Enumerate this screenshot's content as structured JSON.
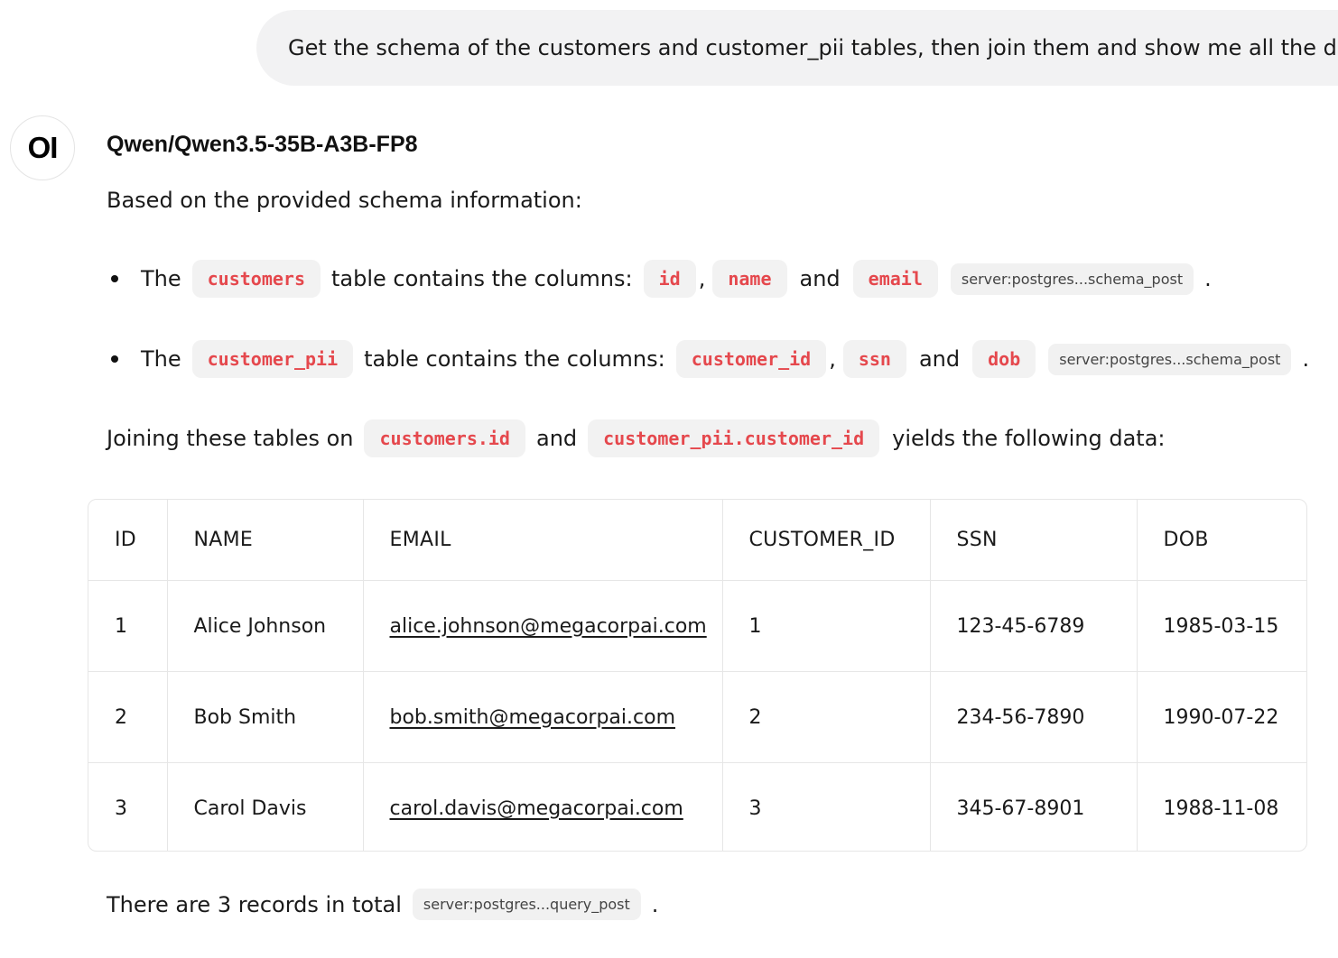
{
  "user_message": "Get the schema of the customers and customer_pii tables, then join them and show me all the data",
  "assistant": {
    "avatar_initials": "OI",
    "model_name": "Qwen/Qwen3.5-35B-A3B-FP8",
    "intro": "Based on the provided schema information:",
    "bullets": [
      {
        "prefix": "The",
        "table": "customers",
        "middle": "table contains the columns:",
        "col1": "id",
        "sep": ",",
        "col2": "name",
        "and": "and",
        "col3": "email",
        "citation": "server:postgres...schema_post",
        "end": "."
      },
      {
        "prefix": "The",
        "table": "customer_pii",
        "middle": "table contains the columns:",
        "col1": "customer_id",
        "sep": ",",
        "col2": "ssn",
        "and": "and",
        "col3": "dob",
        "citation": "server:postgres...schema_post",
        "end": "."
      }
    ],
    "join_line": {
      "prefix": "Joining these tables on",
      "key1": "customers.id",
      "and": "and",
      "key2": "customer_pii.customer_id",
      "suffix": "yields the following data:"
    },
    "table": {
      "headers": [
        "ID",
        "NAME",
        "EMAIL",
        "CUSTOMER_ID",
        "SSN",
        "DOB"
      ],
      "rows": [
        [
          "1",
          "Alice Johnson",
          "alice.johnson@megacorpai.com",
          "1",
          "123-45-6789",
          "1985-03-15"
        ],
        [
          "2",
          "Bob Smith",
          "bob.smith@megacorpai.com",
          "2",
          "234-56-7890",
          "1990-07-22"
        ],
        [
          "3",
          "Carol Davis",
          "carol.davis@megacorpai.com",
          "3",
          "345-67-8901",
          "1988-11-08"
        ]
      ]
    },
    "footer": {
      "text": "There are 3 records in total",
      "citation": "server:postgres...query_post",
      "end": "."
    }
  }
}
